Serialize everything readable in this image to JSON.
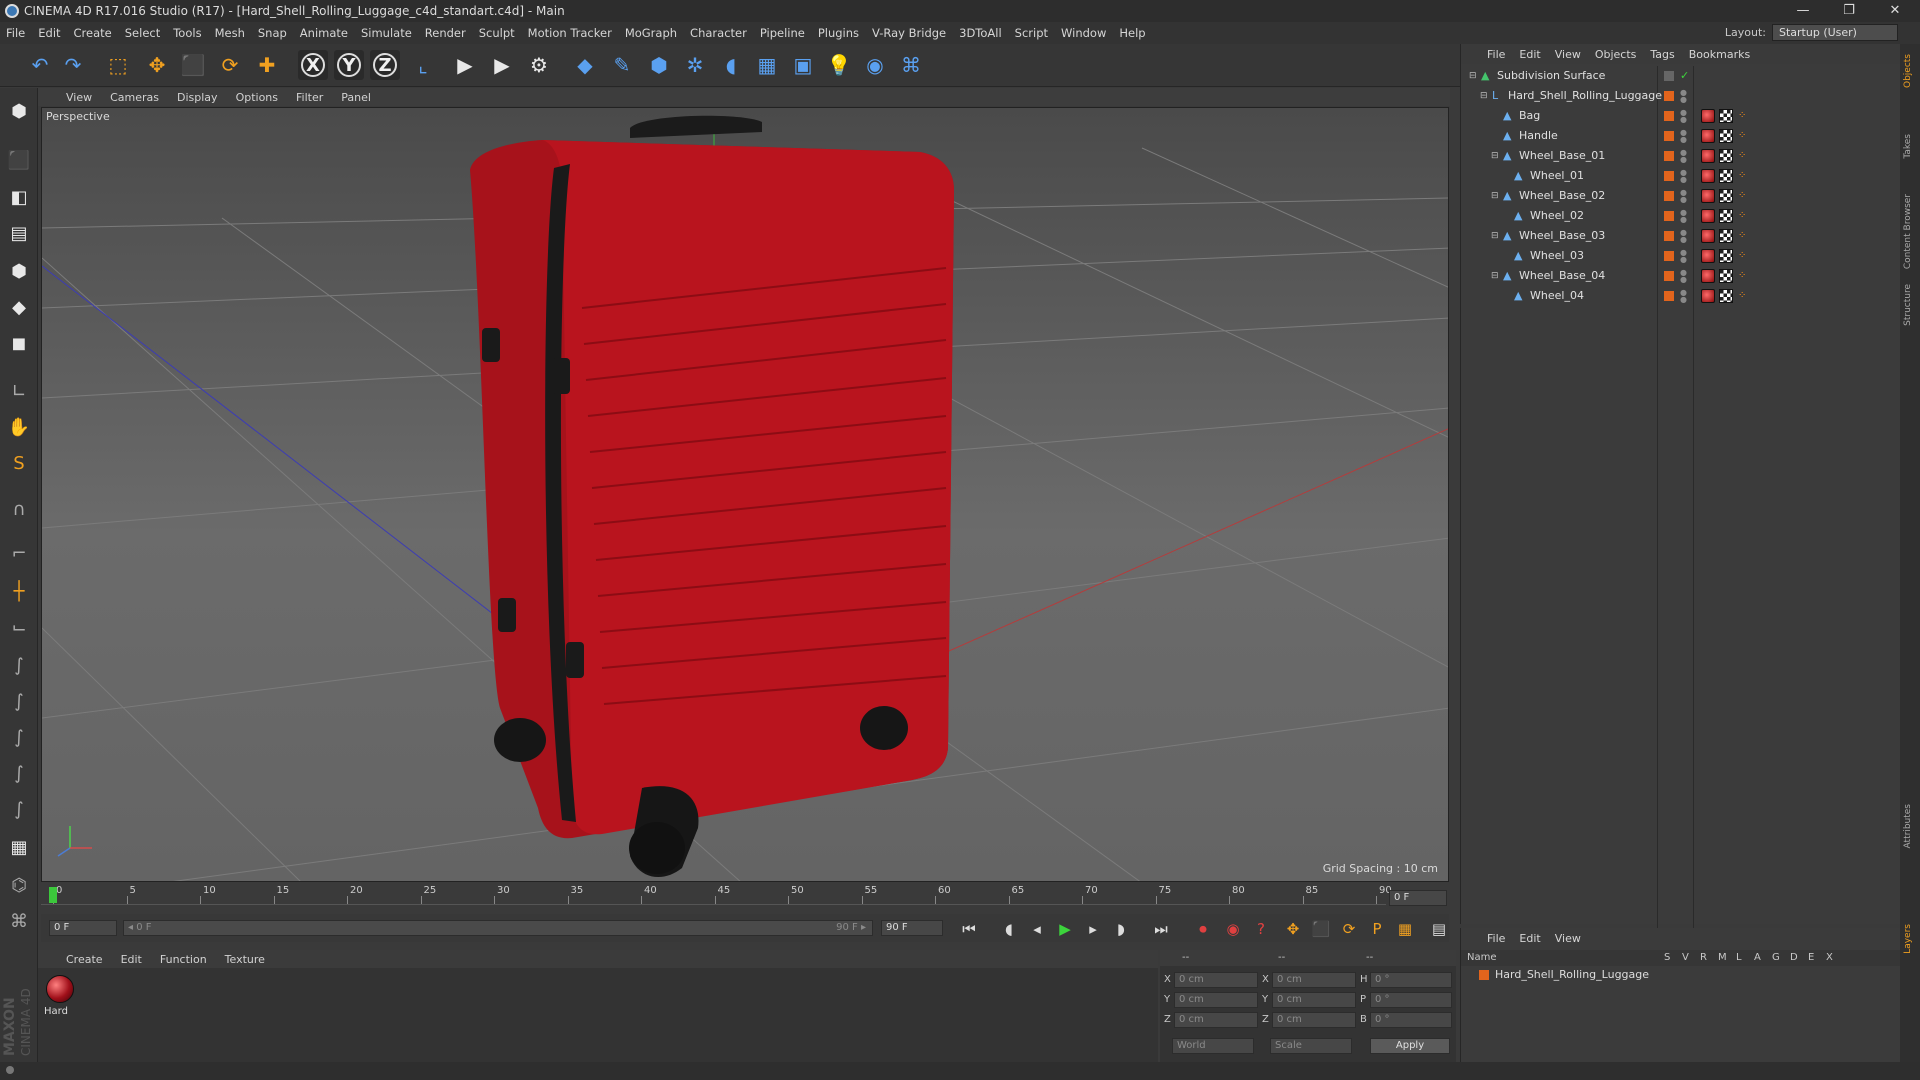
{
  "window": {
    "title": "CINEMA 4D R17.016 Studio (R17) - [Hard_Shell_Rolling_Luggage_c4d_standart.c4d] - Main",
    "minimize": "—",
    "maximize": "❐",
    "close": "✕"
  },
  "menu": [
    "File",
    "Edit",
    "Create",
    "Select",
    "Tools",
    "Mesh",
    "Snap",
    "Animate",
    "Simulate",
    "Render",
    "Sculpt",
    "Motion Tracker",
    "MoGraph",
    "Character",
    "Pipeline",
    "Plugins",
    "V-Ray Bridge",
    "3DToAll",
    "Script",
    "Window",
    "Help"
  ],
  "layout": {
    "label": "Layout:",
    "value": "Startup (User)"
  },
  "axis_buttons": [
    "X",
    "Y",
    "Z"
  ],
  "viewport": {
    "menu": [
      "View",
      "Cameras",
      "Display",
      "Options",
      "Filter",
      "Panel"
    ],
    "label": "Perspective",
    "grid_spacing": "Grid Spacing : 10 cm"
  },
  "timeline": {
    "ticks": [
      "0",
      "5",
      "10",
      "15",
      "20",
      "25",
      "30",
      "35",
      "40",
      "45",
      "50",
      "55",
      "60",
      "65",
      "70",
      "75",
      "80",
      "85",
      "90"
    ],
    "current_frame": "0 F",
    "start_field": "0 F",
    "range_start": "◂ 0 F",
    "range_end": "90 F ▸",
    "end_field": "90 F",
    "icon_row_note": ""
  },
  "material_panel": {
    "menu": [
      "Create",
      "Edit",
      "Function",
      "Texture"
    ],
    "material_label": "Hard"
  },
  "coords": {
    "header_left": "--",
    "header_mid": "--",
    "header_right": "--",
    "rows": [
      {
        "a": "X",
        "av": "0 cm",
        "b": "X",
        "bv": "0 cm",
        "c": "H",
        "cv": "0 °"
      },
      {
        "a": "Y",
        "av": "0 cm",
        "b": "Y",
        "bv": "0 cm",
        "c": "P",
        "cv": "0 °"
      },
      {
        "a": "Z",
        "av": "0 cm",
        "b": "Z",
        "bv": "0 cm",
        "c": "B",
        "cv": "0 °"
      }
    ],
    "world": "World",
    "scale": "Scale",
    "apply": "Apply"
  },
  "object_manager": {
    "menu": [
      "File",
      "Edit",
      "View",
      "Objects",
      "Tags",
      "Bookmarks"
    ],
    "objects": [
      {
        "name": "Subdivision Surface",
        "indent": 0,
        "tags": false
      },
      {
        "name": "Hard_Shell_Rolling_Luggage",
        "indent": 1,
        "tags": false
      },
      {
        "name": "Bag",
        "indent": 2,
        "tags": true
      },
      {
        "name": "Handle",
        "indent": 2,
        "tags": true
      },
      {
        "name": "Wheel_Base_01",
        "indent": 2,
        "tags": true
      },
      {
        "name": "Wheel_01",
        "indent": 3,
        "tags": true
      },
      {
        "name": "Wheel_Base_02",
        "indent": 2,
        "tags": true
      },
      {
        "name": "Wheel_02",
        "indent": 3,
        "tags": true
      },
      {
        "name": "Wheel_Base_03",
        "indent": 2,
        "tags": true
      },
      {
        "name": "Wheel_03",
        "indent": 3,
        "tags": true
      },
      {
        "name": "Wheel_Base_04",
        "indent": 2,
        "tags": true
      },
      {
        "name": "Wheel_04",
        "indent": 3,
        "tags": true
      }
    ]
  },
  "layer_manager": {
    "menu": [
      "File",
      "Edit",
      "View"
    ],
    "col_name": "Name",
    "cols": [
      "S",
      "V",
      "R",
      "M",
      "L",
      "A",
      "G",
      "D",
      "E",
      "X"
    ],
    "row": "Hard_Shell_Rolling_Luggage"
  },
  "side_tabs": [
    "Objects",
    "Takes",
    "Content Browser",
    "Structure",
    "Attributes",
    "Layers"
  ],
  "brand": {
    "maxon": "MAXON",
    "cinema": "CINEMA 4D"
  },
  "colors": {
    "accent": "#e2641c",
    "luggage": "#b3121c",
    "blue_icon": "#3c8ce8"
  }
}
